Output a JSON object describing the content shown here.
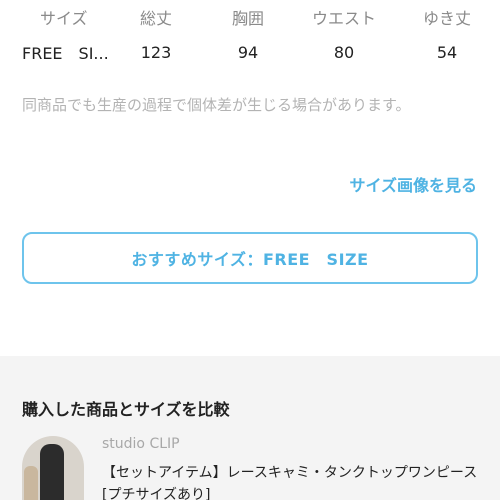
{
  "size_table": {
    "headers": [
      "サイズ",
      "総丈",
      "胸囲",
      "ウエスト",
      "ゆき丈"
    ],
    "rows": [
      [
        "FREE　SI...",
        "123",
        "94",
        "80",
        "54"
      ]
    ]
  },
  "note": "同商品でも生産の過程で個体差が生じる場合があります。",
  "size_image_link": "サイズ画像を見る",
  "recommend_label": "おすすめサイズ：FREE　SIZE",
  "compare": {
    "title": "購入した商品とサイズを比較",
    "brand": "studio CLIP",
    "item_name": "【セットアイテム】レースキャミ・タンクトップワンピース[プチサイズあり]"
  },
  "colors": {
    "accent": "#4fb3e3",
    "section_bg": "#f4f4f4"
  }
}
